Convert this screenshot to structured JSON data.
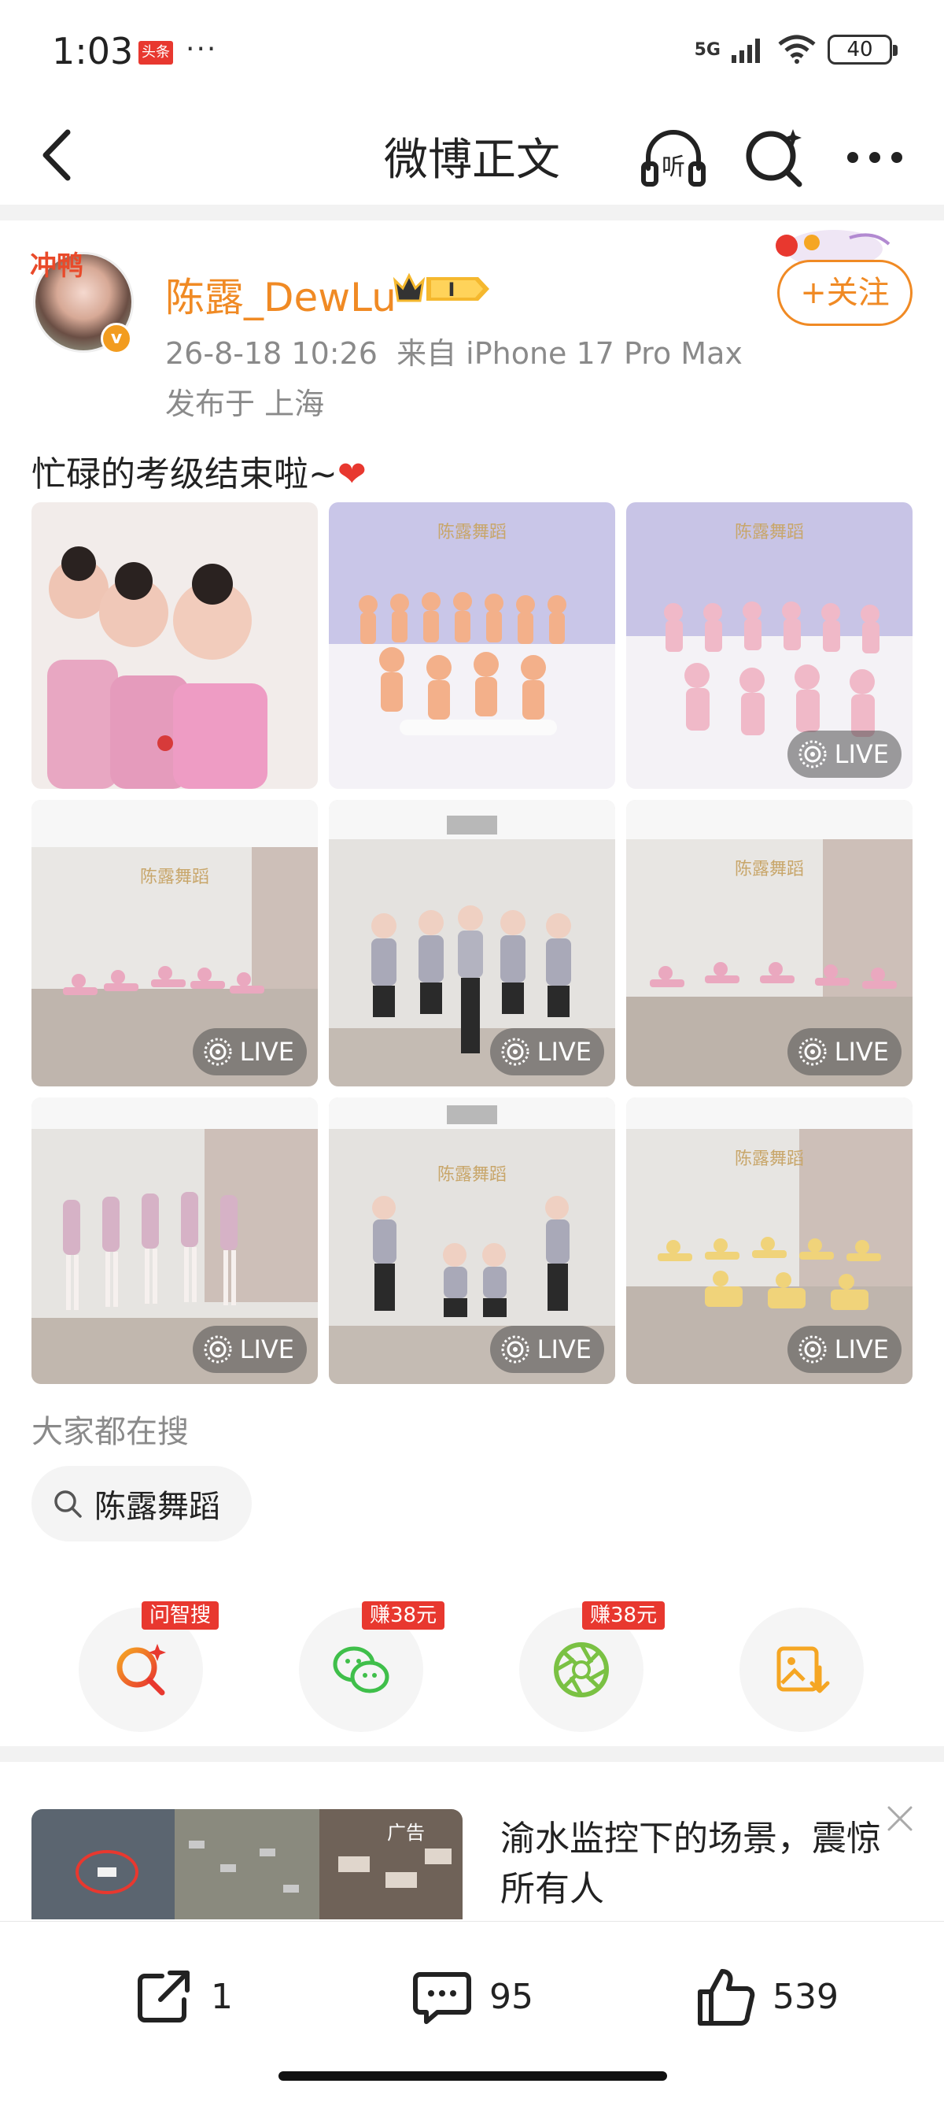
{
  "status_bar": {
    "time": "1:03",
    "app_badge": "头条",
    "more": "···",
    "network": "5G",
    "battery": "40"
  },
  "nav": {
    "title": "微博正文",
    "icons": [
      "back-icon",
      "listen-icon",
      "search-icon",
      "more-icon"
    ]
  },
  "post": {
    "author": "陈露_DewLu",
    "avatar_deco": "冲鸭",
    "timestamp": "26-8-18 10:26",
    "source": "来自 iPhone 17 Pro Max",
    "location": "发布于 上海",
    "follow_label": "+关注",
    "text": "忙碌的考级结束啦~",
    "heart": "❤",
    "images": [
      {
        "scene": "portrait",
        "live": false
      },
      {
        "scene": "group-seated",
        "watermark": "陈露舞蹈",
        "live": false
      },
      {
        "scene": "group-seated",
        "watermark": "陈露舞蹈",
        "live": true,
        "live_label": "LIVE"
      },
      {
        "scene": "studio-split",
        "watermark": "陈露舞蹈",
        "live": true,
        "live_label": "LIVE"
      },
      {
        "scene": "teachers",
        "live": true,
        "live_label": "LIVE"
      },
      {
        "scene": "studio-split",
        "watermark": "陈露舞蹈",
        "live": true,
        "live_label": "LIVE"
      },
      {
        "scene": "dancing",
        "live": true,
        "live_label": "LIVE"
      },
      {
        "scene": "teachers-pose",
        "watermark": "陈露舞蹈",
        "live": true,
        "live_label": "LIVE"
      },
      {
        "scene": "studio-split",
        "watermark": "陈露舞蹈",
        "live": true,
        "live_label": "LIVE"
      }
    ]
  },
  "search_suggest": {
    "heading": "大家都在搜",
    "chip": "陈露舞蹈"
  },
  "share": [
    {
      "icon": "ai-search-icon",
      "tag": "问智搜",
      "color": "#e8382f"
    },
    {
      "icon": "wechat-icon",
      "tag": "赚38元",
      "color": "#3fbf4a"
    },
    {
      "icon": "moments-icon",
      "tag": "赚38元",
      "color": "#7ac143"
    },
    {
      "icon": "save-image-icon",
      "tag": "",
      "color": "#f5a623"
    }
  ],
  "ad": {
    "tag": "广告",
    "title": "渝水监控下的场景，震惊所有人"
  },
  "actions": {
    "repost_count": "1",
    "comment_count": "95",
    "like_count": "539"
  },
  "colors": {
    "accent": "#f08a24",
    "red": "#e8382f",
    "meta_gray": "#8a8a8a"
  }
}
